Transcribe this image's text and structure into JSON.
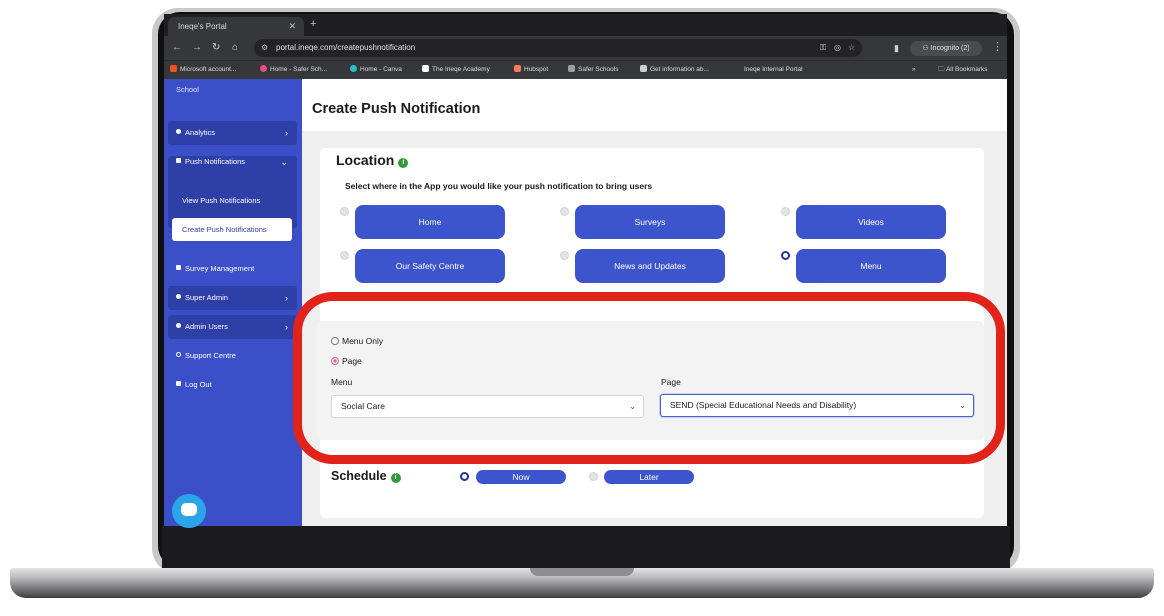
{
  "browser": {
    "tab_title": "Ineqe's Portal",
    "url": "portal.ineqe.com/createpushnotification",
    "incognito_label": "Incognito (2)",
    "bookmarks": [
      "Microsoft account...",
      "Home - Safer Sch...",
      "Home - Canva",
      "The Ineqe Academy",
      "Hubspot",
      "Safer Schools",
      "Get information ab...",
      "Ineqe Internal Portal"
    ],
    "all_bookmarks_label": "All Bookmarks"
  },
  "sidebar": {
    "school_label": "School",
    "items": {
      "analytics": "Analytics",
      "push_notifications": "Push Notifications",
      "view_push": "View Push Notifications",
      "create_push": "Create Push Notifications",
      "survey_management": "Survey Management",
      "super_admin": "Super Admin",
      "admin_users": "Admin Users",
      "support_centre": "Support Centre",
      "log_out": "Log Out"
    }
  },
  "page": {
    "title": "Create Push Notification"
  },
  "location": {
    "heading": "Location",
    "subtitle": "Select where in the App you would like your push notification to bring users",
    "options": [
      "Home",
      "Surveys",
      "Videos",
      "Our Safety Centre",
      "News and Updates",
      "Menu"
    ],
    "selected": "Menu"
  },
  "menu_target": {
    "radio_menu_only": "Menu Only",
    "radio_page": "Page",
    "selected": "Page",
    "menu_label": "Menu",
    "menu_value": "Social Care",
    "page_label": "Page",
    "page_value": "SEND (Special Educational Needs and Disability)"
  },
  "schedule": {
    "heading": "Schedule",
    "now_label": "Now",
    "later_label": "Later",
    "selected": "Now"
  },
  "colors": {
    "sidebar": "#3b4fc9",
    "button": "#3c54cc",
    "highlight": "#e2231a",
    "info_icon": "#2f9a3e"
  }
}
